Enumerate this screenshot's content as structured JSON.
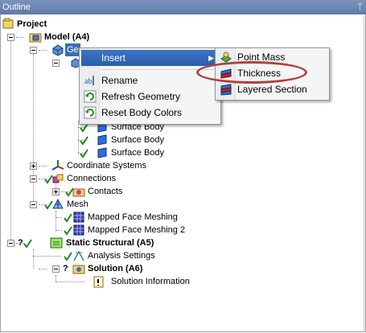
{
  "panel": {
    "title": "Outline",
    "pin_glyph": "ᛘ"
  },
  "tree": {
    "project": "Project",
    "model": "Model (A4)",
    "geometry": "Ge",
    "surface_bodies": [
      "Surface Body",
      "Surface Body",
      "Surface Body"
    ],
    "coordinate_systems": "Coordinate Systems",
    "connections": "Connections",
    "contacts": "Contacts",
    "mesh": "Mesh",
    "mapped_face_meshing": "Mapped Face Meshing",
    "mapped_face_meshing_2": "Mapped Face Meshing 2",
    "static_structural": "Static Structural (A5)",
    "analysis_settings": "Analysis Settings",
    "solution": "Solution (A6)",
    "solution_information": "Solution Information"
  },
  "context_menu": {
    "insert": "Insert",
    "rename": "Rename",
    "refresh_geometry": "Refresh Geometry",
    "reset_body_colors": "Reset Body Colors"
  },
  "submenu": {
    "point_mass": "Point Mass",
    "thickness": "Thickness",
    "layered_section": "Layered Section"
  },
  "colors": {
    "highlight": "#2a5ea8",
    "annotation_ellipse": "#b0413e"
  }
}
